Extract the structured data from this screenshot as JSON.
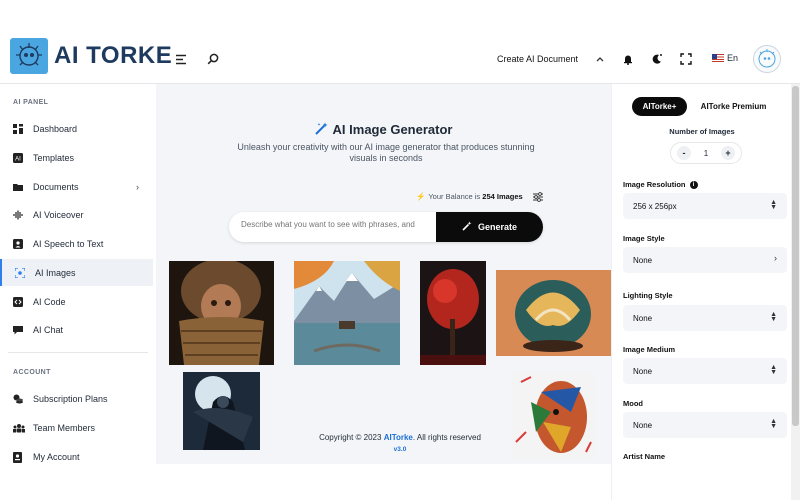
{
  "header": {
    "app_name": "AI TORKE",
    "create_doc_label": "Create AI Document",
    "language": "En"
  },
  "sidebar": {
    "section_ai_panel": "AI PANEL",
    "section_account": "ACCOUNT",
    "items": [
      {
        "label": "Dashboard",
        "icon": "dashboard-icon"
      },
      {
        "label": "Templates",
        "icon": "templates-icon"
      },
      {
        "label": "Documents",
        "icon": "folder-icon"
      },
      {
        "label": "AI Voiceover",
        "icon": "waveform-icon"
      },
      {
        "label": "AI Speech to Text",
        "icon": "speech-icon"
      },
      {
        "label": "AI Images",
        "icon": "image-scan-icon"
      },
      {
        "label": "AI Code",
        "icon": "code-icon"
      },
      {
        "label": "AI Chat",
        "icon": "chat-icon"
      }
    ],
    "account_items": [
      {
        "label": "Subscription Plans",
        "icon": "coins-icon"
      },
      {
        "label": "Team Members",
        "icon": "team-icon"
      },
      {
        "label": "My Account",
        "icon": "account-icon"
      }
    ]
  },
  "main": {
    "title": "AI Image Generator",
    "subtitle": "Unleash your creativity with our AI image generator that produces stunning visuals in seconds",
    "balance_prefix": "Your Balance is",
    "balance_value": "254 Images",
    "prompt_placeholder": "Describe what you want to see with phrases, and",
    "generate_label": "Generate",
    "footer_prefix": "Copyright © 2023",
    "footer_brand": "AITorke",
    "footer_suffix": ". All rights reserved",
    "version": "v3.0"
  },
  "right_panel": {
    "tab_plus": "AITorke+",
    "tab_premium": "AITorke Premium",
    "number_of_images_label": "Number of Images",
    "number_of_images_value": "1",
    "minus": "-",
    "plus": "+",
    "resolution_label": "Image Resolution",
    "resolution_value": "256 x 256px",
    "style_label": "Image Style",
    "style_value": "None",
    "lighting_label": "Lighting Style",
    "lighting_value": "None",
    "medium_label": "Image Medium",
    "medium_value": "None",
    "mood_label": "Mood",
    "mood_value": "None",
    "artist_label": "Artist Name"
  },
  "colors": {
    "accent": "#2f80ed",
    "brand_dark": "#1e3a5f",
    "button_dark": "#0b0b0c",
    "main_bg": "#f3f5f8"
  }
}
